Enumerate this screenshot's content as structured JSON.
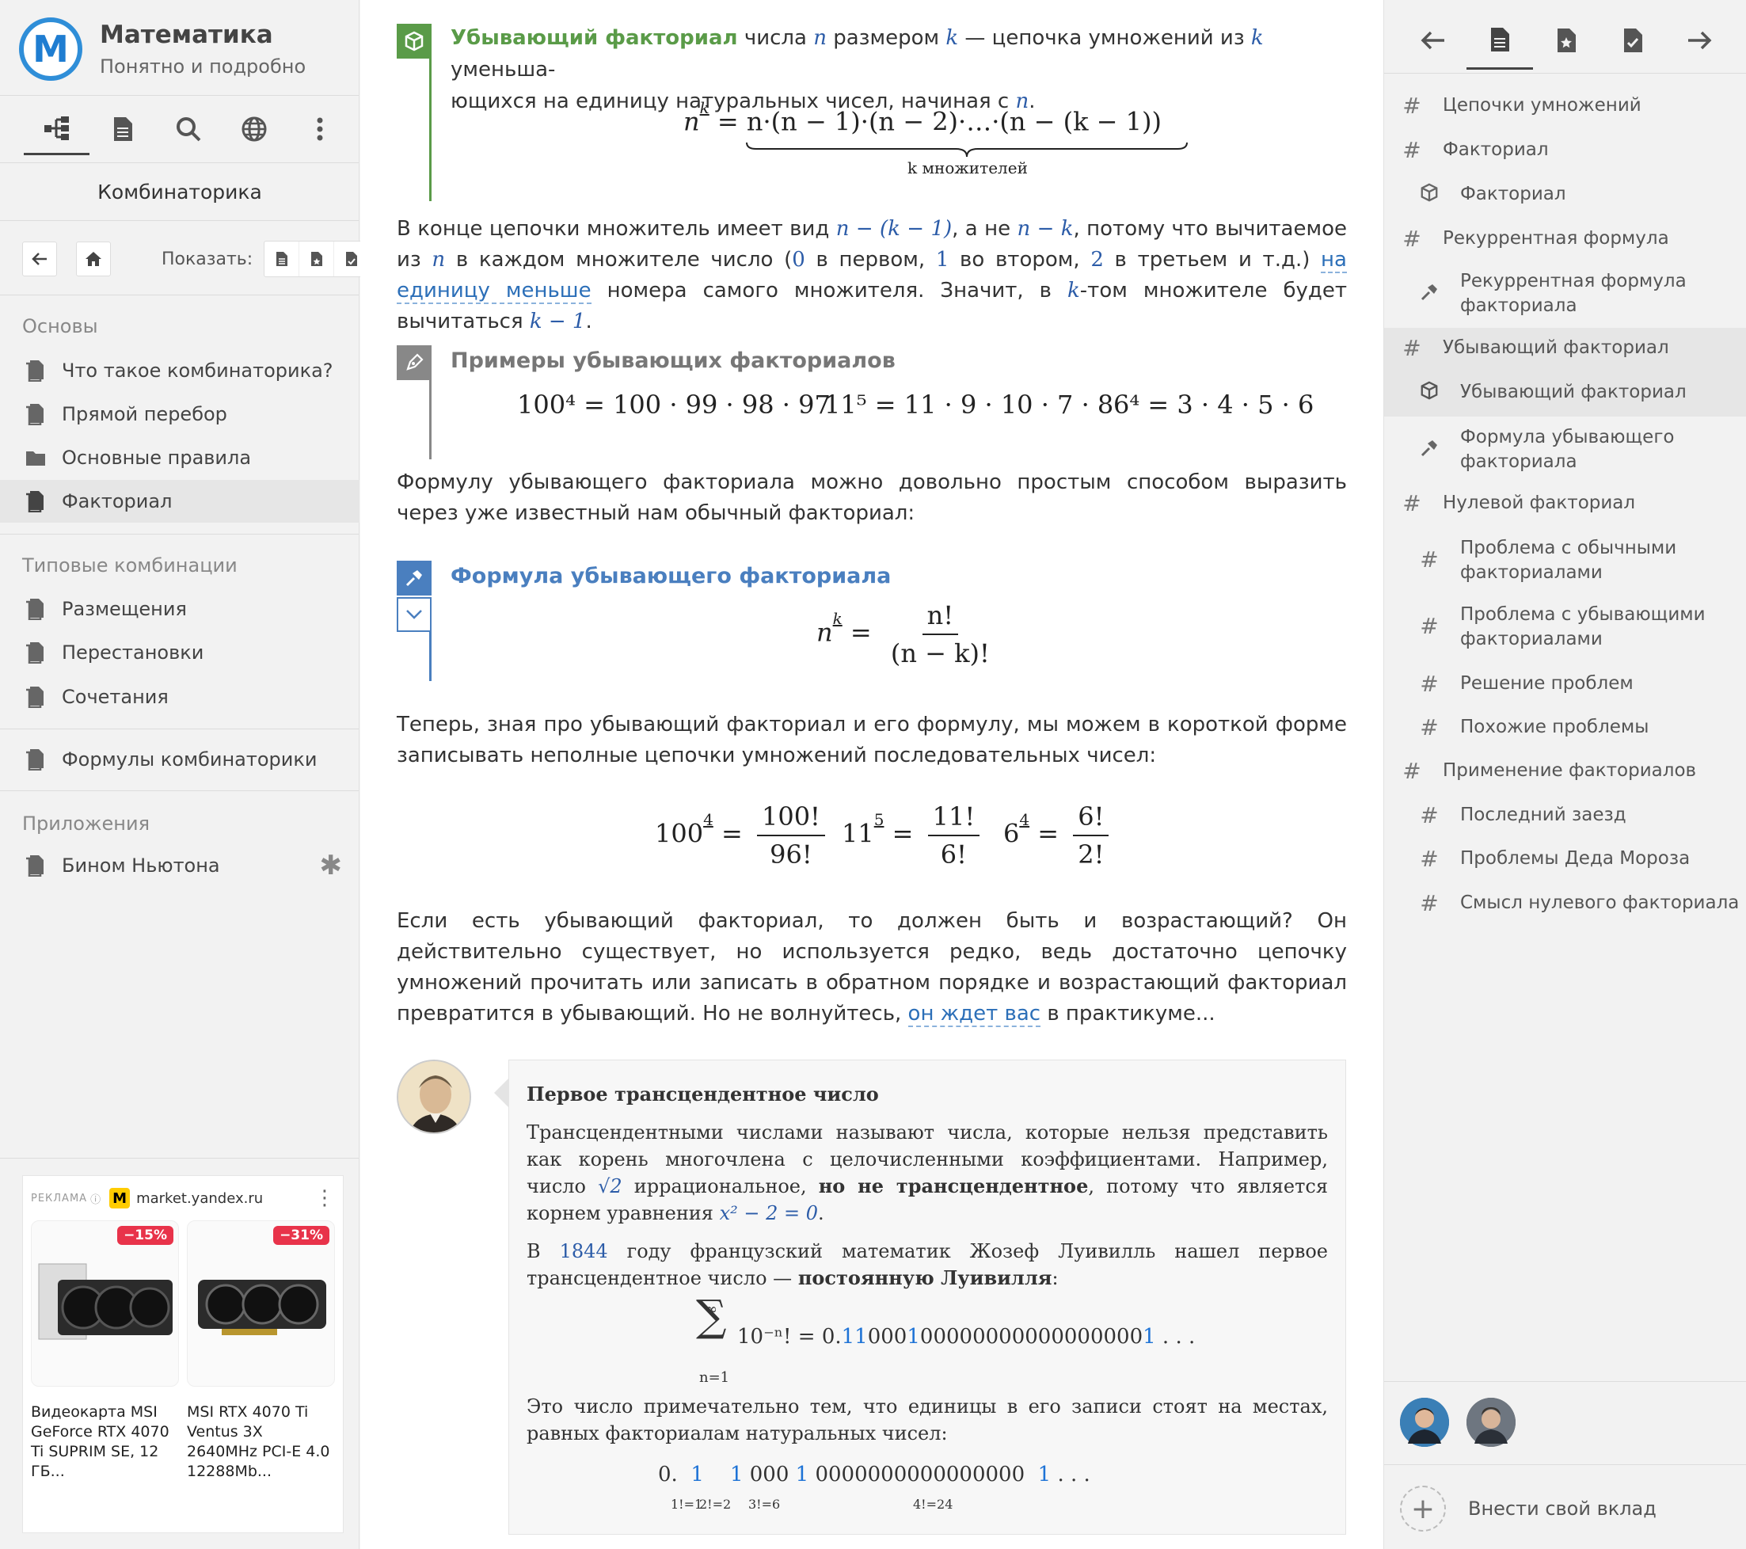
{
  "app": {
    "title": "Математика",
    "subtitle": "Понятно и подробно",
    "logo_letter": "M"
  },
  "left_nav": {
    "section": "Комбинаторика",
    "show_label": "Показать:"
  },
  "groups": [
    {
      "title": "Основы",
      "items": [
        "Что такое комбинаторика?",
        "Прямой перебор",
        "Основные правила",
        "Факториал"
      ]
    },
    {
      "title": "Типовые комбинации",
      "items": [
        "Размещения",
        "Перестановки",
        "Сочетания"
      ]
    },
    {
      "title": "",
      "items": [
        "Формулы комбинаторики"
      ]
    },
    {
      "title": "Приложения",
      "items": [
        "Бином Ньютона"
      ]
    }
  ],
  "ad": {
    "label": "РЕКЛАМА",
    "site": "market.yandex.ru",
    "cards": [
      {
        "badge": "−15%",
        "text": "Видеокарта MSI GeForce RTX 4070 Ti SUPRIM SE, 12 ГБ..."
      },
      {
        "badge": "−31%",
        "text": "MSI RTX 4070 Ti Ventus 3X 2640MHz PCI-E 4.0 12288Mb..."
      }
    ]
  },
  "main": {
    "def": {
      "title": "Убывающий факториал",
      "text1": " числа ",
      "n": "n",
      "text2": " размером ",
      "k": "k",
      "text3": " — цепочка умножений из ",
      "text4": " уменьша-",
      "line2": "ющихся на единицу натуральных чисел, начиная с ",
      "formula": "n·(n − 1)·(n − 2)·…·(n − (k − 1))",
      "brace_label": "k множителей"
    },
    "p1a": "В конце цепочки множитель имеет вид ",
    "p1m1": "n − (k − 1)",
    "p1b": ", а не ",
    "p1m2": "n − k",
    "p1c": ", потому что вычитаемое из",
    "p1d": " в каждом множителе число (",
    "p1e": " в первом, ",
    "p1f": " во втором, ",
    "p1g": " в третьем и т.д.) ",
    "p1link": "на единицу меньше",
    "p1h": " номера самого множителя. Значит, в ",
    "p1i": "-том множителе будет вычитаться ",
    "p1m3": "k − 1",
    "examples": {
      "title": "Примеры убывающих факториалов",
      "e1": "100⁴ = 100 · 99 · 98 · 97",
      "e2": "11⁵ = 11 · 9 · 10 · 7 · 8",
      "e3": "6⁴ = 3 · 4 · 5 · 6"
    },
    "p2": "Формулу убывающего факториала можно довольно простым способом выразить через уже известный нам обычный факториал:",
    "formula_block": {
      "title": "Формула убывающего факториала",
      "num": "n!",
      "den": "(n − k)!"
    },
    "p3": "Теперь, зная про убывающий факториал и его формулу, мы можем в короткой форме записывать неполные цепочки умножений последовательных чисел:",
    "fr": [
      {
        "lhs": "100",
        "num": "100!",
        "den": "96!"
      },
      {
        "lhs": "11",
        "num": "11!",
        "den": "6!"
      },
      {
        "lhs": "6",
        "num": "6!",
        "den": "2!"
      }
    ],
    "p4a": "Если есть убывающий факториал, то должен быть и возрастающий? Он действительно существует, но используется редко, ведь достаточно цепочку умножений прочитать или записать в обратном порядке и возрастающий факториал превратится в убывающий. Но не волнуйтесь, ",
    "p4link": "он ждет вас",
    "p4b": " в практикуме..."
  },
  "note": {
    "title": "Первое трансцендентное число",
    "p1a": "Трансцендентными числами называют числа, которые нельзя представить как корень многочлена с целочисленными коэффициентами. Например, число ",
    "p1sqrt": "√2",
    "p1b": " иррациональное, ",
    "p1bold": "но не трансцендентное",
    "p1c": ", потому что является корнем уравнения ",
    "p1eq": "x² − 2 = 0",
    "p2a": "В ",
    "year": "1844",
    "p2b": " году французский математик Жозеф Луивилль нашел первое трансцендентное число — ",
    "p2bold": "постоянную Луивилля",
    "sum_top": "∞",
    "sum_bot": "n=1",
    "sum_expr": "10⁻ⁿ! = 0.",
    "p3": "Это число примечательно тем, что единицы в его записи стоят на местах, равных факториалам натуральных чисел:",
    "facts": [
      "1!=1",
      "2!=2",
      "3!=6",
      "4!=24"
    ]
  },
  "toc": [
    {
      "level": 1,
      "icon": "hash",
      "text": "Цепочки умножений"
    },
    {
      "level": 1,
      "icon": "hash",
      "text": "Факториал"
    },
    {
      "level": 2,
      "icon": "cube",
      "text": "Факториал"
    },
    {
      "level": 1,
      "icon": "hash",
      "text": "Рекуррентная формула"
    },
    {
      "level": 2,
      "icon": "hammer",
      "text": "Рекуррентная формула факториала"
    },
    {
      "level": 1,
      "icon": "hash",
      "text": "Убывающий факториал"
    },
    {
      "level": 2,
      "icon": "cube",
      "text": "Убывающий факториал"
    },
    {
      "level": 2,
      "icon": "hammer",
      "text": "Формула убывающего факториала"
    },
    {
      "level": 1,
      "icon": "hash",
      "text": "Нулевой факториал"
    },
    {
      "level": 2,
      "icon": "hash",
      "text": "Проблема с обычными факториалами"
    },
    {
      "level": 2,
      "icon": "hash",
      "text": "Проблема с убывающими факториалами"
    },
    {
      "level": 2,
      "icon": "hash",
      "text": "Решение проблем"
    },
    {
      "level": 2,
      "icon": "hash",
      "text": "Похожие проблемы"
    },
    {
      "level": 1,
      "icon": "hash",
      "text": "Применение факториалов"
    },
    {
      "level": 2,
      "icon": "hash",
      "text": "Последний заезд"
    },
    {
      "level": 2,
      "icon": "hash",
      "text": "Проблемы Деда Мороза"
    },
    {
      "level": 2,
      "icon": "hash",
      "text": "Смысл нулевого факториала"
    }
  ],
  "contribute": "Внести свой вклад",
  "colors": {
    "green": "#5a9b48",
    "blue": "#4a7fbf",
    "gray": "#888888",
    "accent_blue": "#1e73d6"
  }
}
